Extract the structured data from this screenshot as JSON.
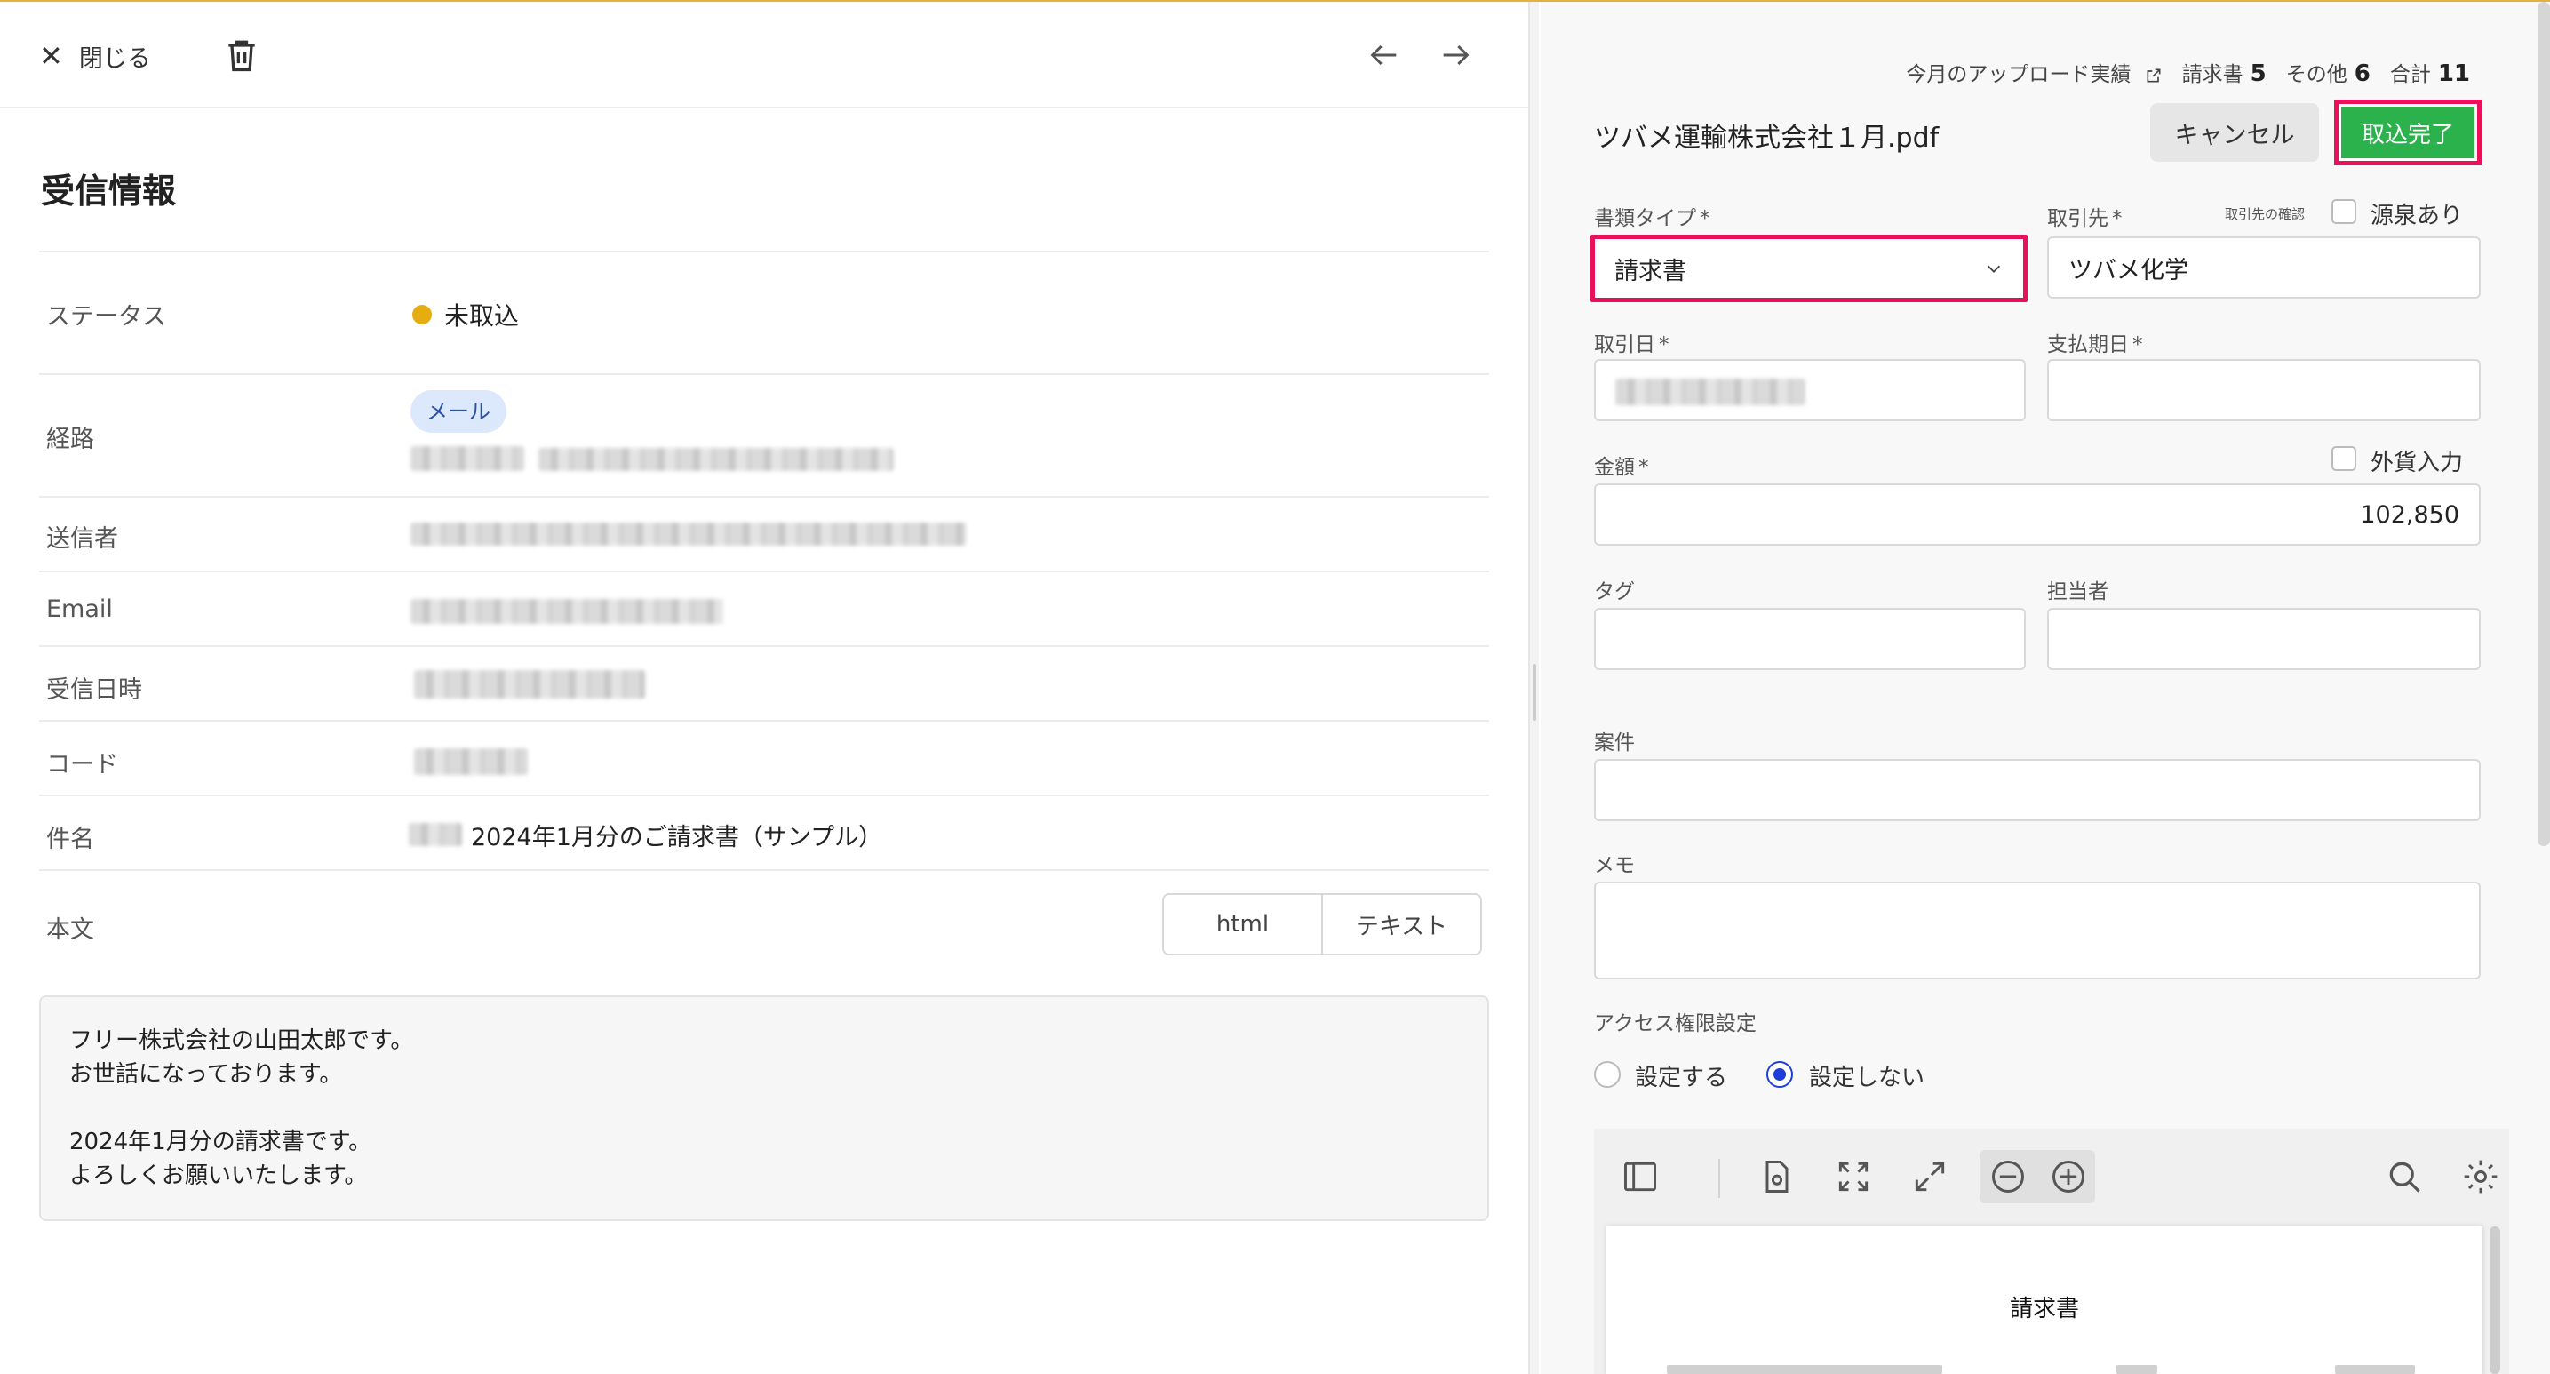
{
  "header": {
    "close_label": "閉じる"
  },
  "info": {
    "title": "受信情報",
    "status_label": "ステータス",
    "status_value": "未取込",
    "route_label": "経路",
    "route_badge": "メール",
    "sender_label": "送信者",
    "email_label": "Email",
    "received_label": "受信日時",
    "code_label": "コード",
    "subject_label": "件名",
    "subject_value": "2024年1月分のご請求書（サンプル）",
    "body_label": "本文",
    "body_tabs": [
      "html",
      "テキスト"
    ],
    "body_lines": [
      "フリー株式会社の山田太郎です。",
      "お世話になっております。",
      "",
      "2024年1月分の請求書です。",
      "よろしくお願いいたします。"
    ]
  },
  "stats": {
    "upload_label": "今月のアップロード実績",
    "invoice_label": "請求書",
    "invoice_count": "5",
    "other_label": "その他",
    "other_count": "6",
    "total_label": "合計",
    "total_count": "11"
  },
  "form": {
    "filename": "ツバメ運輸株式会社１月.pdf",
    "cancel_label": "キャンセル",
    "done_label": "取込完了",
    "doc_type_label": "書類タイプ",
    "doc_type_value": "請求書",
    "partner_label": "取引先",
    "partner_check_label": "取引先の確認",
    "withholding_label": "源泉あり",
    "partner_value": "ツバメ化学",
    "date_label": "取引日",
    "due_label": "支払期日",
    "amount_label": "金額",
    "foreign_label": "外貨入力",
    "amount_value": "102,850",
    "tag_label": "タグ",
    "owner_label": "担当者",
    "project_label": "案件",
    "memo_label": "メモ",
    "access_label": "アクセス権限設定",
    "access_set": "設定する",
    "access_unset": "設定しない",
    "required_mark": "*"
  },
  "viewer": {
    "page_title": "請求書"
  },
  "colors": {
    "accent_green": "#2bb24c",
    "highlight": "#e8115a",
    "status_yellow": "#e6ad10",
    "radio_blue": "#1d3fd8"
  },
  "icons": [
    "close-icon",
    "trash-icon",
    "arrow-left-icon",
    "arrow-right-icon",
    "external-link-icon",
    "chevron-down-icon",
    "sidebar-toggle-icon",
    "page-fit-icon",
    "fullscreen-icon",
    "expand-icon",
    "zoom-out-icon",
    "zoom-in-icon",
    "search-icon",
    "gear-icon"
  ]
}
